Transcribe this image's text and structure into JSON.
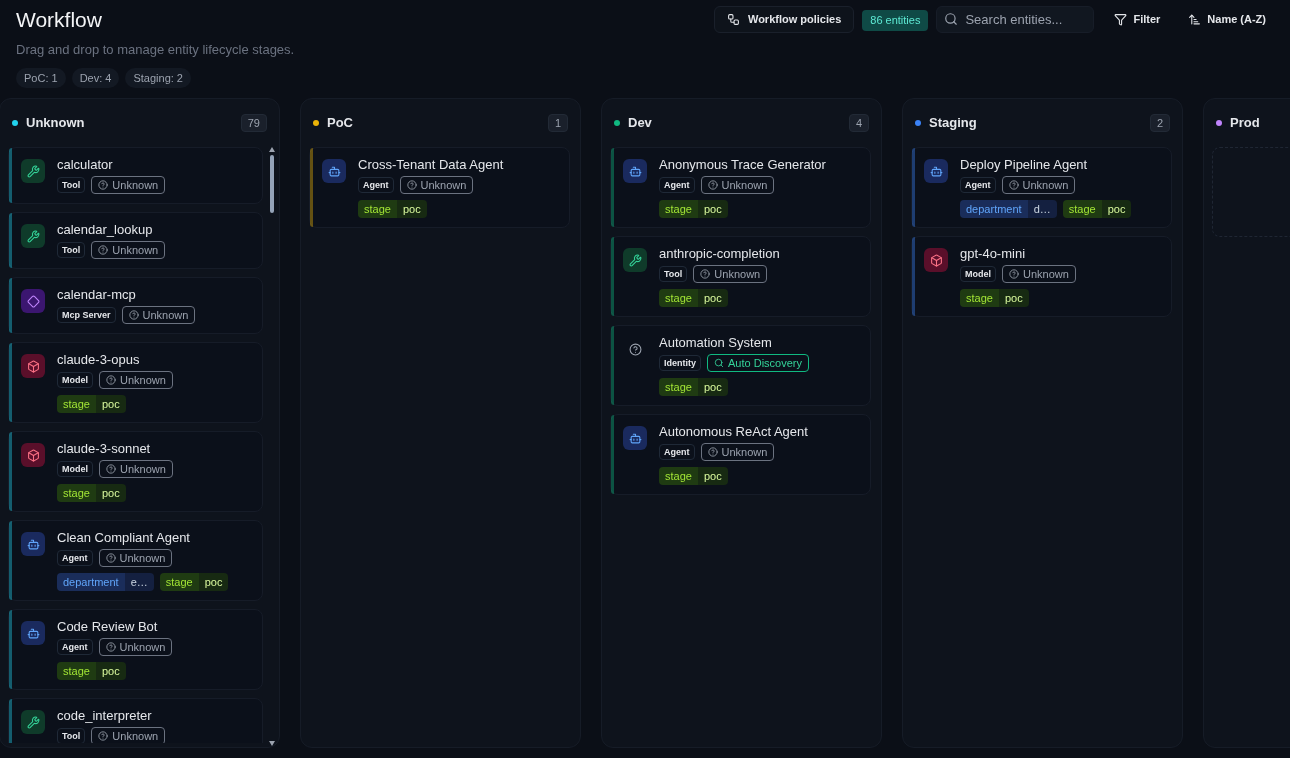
{
  "header": {
    "title": "Workflow",
    "subtitle": "Drag and drop to manage entity lifecycle stages.",
    "stage_counts": [
      "PoC: 1",
      "Dev: 4",
      "Staging: 2"
    ]
  },
  "toolbar": {
    "policies_button": "Workflow policies",
    "entity_count": "86 entities",
    "search": {
      "placeholder": "Search entities..."
    },
    "filter_button": "Filter",
    "sort_button": "Name (A-Z)"
  },
  "columns": [
    {
      "title": "Unknown",
      "count": "79",
      "color": "#22d3ee",
      "cards": [
        {
          "name": "calculator",
          "kind": "tool",
          "type": "Tool",
          "status": {
            "kind": "unknown",
            "label": "Unknown"
          }
        },
        {
          "name": "calendar_lookup",
          "kind": "tool",
          "type": "Tool",
          "status": {
            "kind": "unknown",
            "label": "Unknown"
          }
        },
        {
          "name": "calendar-mcp",
          "kind": "mcp",
          "type": "Mcp Server",
          "status": {
            "kind": "unknown",
            "label": "Unknown"
          }
        },
        {
          "name": "claude-3-opus",
          "kind": "model",
          "type": "Model",
          "status": {
            "kind": "unknown",
            "label": "Unknown"
          },
          "tags": [
            {
              "kind": "stage",
              "key": "stage",
              "value": "poc"
            }
          ]
        },
        {
          "name": "claude-3-sonnet",
          "kind": "model",
          "type": "Model",
          "status": {
            "kind": "unknown",
            "label": "Unknown"
          },
          "tags": [
            {
              "kind": "stage",
              "key": "stage",
              "value": "poc"
            }
          ]
        },
        {
          "name": "Clean Compliant Agent",
          "kind": "agent",
          "type": "Agent",
          "status": {
            "kind": "unknown",
            "label": "Unknown"
          },
          "tags": [
            {
              "kind": "department",
              "key": "department",
              "value": "e…"
            },
            {
              "kind": "stage",
              "key": "stage",
              "value": "poc"
            }
          ]
        },
        {
          "name": "Code Review Bot",
          "kind": "agent",
          "type": "Agent",
          "status": {
            "kind": "unknown",
            "label": "Unknown"
          },
          "tags": [
            {
              "kind": "stage",
              "key": "stage",
              "value": "poc"
            }
          ]
        },
        {
          "name": "code_interpreter",
          "kind": "tool",
          "type": "Tool",
          "status": {
            "kind": "unknown",
            "label": "Unknown"
          }
        }
      ]
    },
    {
      "title": "PoC",
      "count": "1",
      "color": "#eab308",
      "cards": [
        {
          "name": "Cross-Tenant Data Agent",
          "kind": "agent",
          "type": "Agent",
          "status": {
            "kind": "unknown",
            "label": "Unknown"
          },
          "tags": [
            {
              "kind": "stage",
              "key": "stage",
              "value": "poc"
            }
          ]
        }
      ]
    },
    {
      "title": "Dev",
      "count": "4",
      "color": "#10b981",
      "cards": [
        {
          "name": "Anonymous Trace Generator",
          "kind": "agent",
          "type": "Agent",
          "status": {
            "kind": "unknown",
            "label": "Unknown"
          },
          "tags": [
            {
              "kind": "stage",
              "key": "stage",
              "value": "poc"
            }
          ]
        },
        {
          "name": "anthropic-completion",
          "kind": "tool",
          "type": "Tool",
          "status": {
            "kind": "unknown",
            "label": "Unknown"
          },
          "tags": [
            {
              "kind": "stage",
              "key": "stage",
              "value": "poc"
            }
          ]
        },
        {
          "name": "Automation System",
          "kind": "identity",
          "type": "Identity",
          "status": {
            "kind": "discovery",
            "label": "Auto Discovery"
          },
          "tags": [
            {
              "kind": "stage",
              "key": "stage",
              "value": "poc"
            }
          ]
        },
        {
          "name": "Autonomous ReAct Agent",
          "kind": "agent",
          "type": "Agent",
          "status": {
            "kind": "unknown",
            "label": "Unknown"
          },
          "tags": [
            {
              "kind": "stage",
              "key": "stage",
              "value": "poc"
            }
          ]
        }
      ]
    },
    {
      "title": "Staging",
      "count": "2",
      "color": "#3b82f6",
      "cards": [
        {
          "name": "Deploy Pipeline Agent",
          "kind": "agent",
          "type": "Agent",
          "status": {
            "kind": "unknown",
            "label": "Unknown"
          },
          "tags": [
            {
              "kind": "department",
              "key": "department",
              "value": "d…"
            },
            {
              "kind": "stage",
              "key": "stage",
              "value": "poc"
            }
          ]
        },
        {
          "name": "gpt-4o-mini",
          "kind": "model",
          "type": "Model",
          "status": {
            "kind": "unknown",
            "label": "Unknown"
          },
          "tags": [
            {
              "kind": "stage",
              "key": "stage",
              "value": "poc"
            }
          ]
        }
      ]
    },
    {
      "title": "Prod",
      "color": "#c084fc"
    }
  ]
}
